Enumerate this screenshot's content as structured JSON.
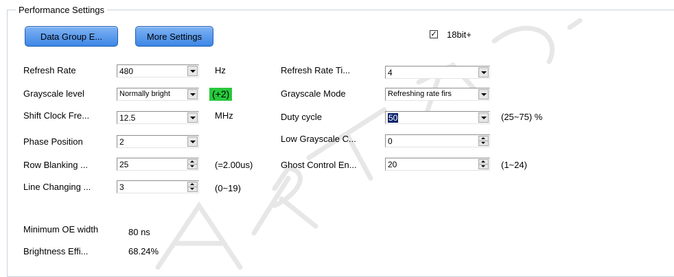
{
  "group": {
    "title": "Performance Settings"
  },
  "buttons": {
    "data_group": "Data Group E...",
    "more_settings": "More Settings"
  },
  "checkbox": {
    "label": "18bit+",
    "checked": true,
    "mark": "✓"
  },
  "left": {
    "refresh_rate": {
      "label": "Refresh Rate",
      "value": "480",
      "unit": "Hz"
    },
    "grayscale_level": {
      "label": "Grayscale level",
      "value": "Normally bright",
      "badge": "(+2)"
    },
    "shift_clock": {
      "label": "Shift Clock Fre...",
      "value": "12.5",
      "unit": "MHz"
    },
    "phase_position": {
      "label": "Phase Position",
      "value": "2"
    },
    "row_blanking": {
      "label": "Row Blanking ...",
      "value": "25",
      "note": "(=2.00us)"
    },
    "line_changing": {
      "label": "Line Changing ...",
      "value": "3",
      "note": "(0~19)"
    }
  },
  "right": {
    "refresh_rate_times": {
      "label": "Refresh Rate Ti...",
      "value": "4"
    },
    "grayscale_mode": {
      "label": "Grayscale Mode",
      "value": "Refreshing rate firs"
    },
    "duty_cycle": {
      "label": "Duty cycle",
      "value": "50",
      "note": "(25~75) %"
    },
    "low_grayscale": {
      "label": "Low Grayscale C...",
      "value": "0"
    },
    "ghost_control": {
      "label": "Ghost Control En...",
      "value": "20",
      "note": "(1~24)"
    }
  },
  "info": {
    "min_oe": {
      "label": "Minimum OE width",
      "value": "80 ns"
    },
    "brightness": {
      "label": "Brightness Effi...",
      "value": "68.24%"
    }
  },
  "colors": {
    "button_top": "#7fb3f3",
    "button_bottom": "#3d86e6",
    "badge": "#28c83c"
  }
}
